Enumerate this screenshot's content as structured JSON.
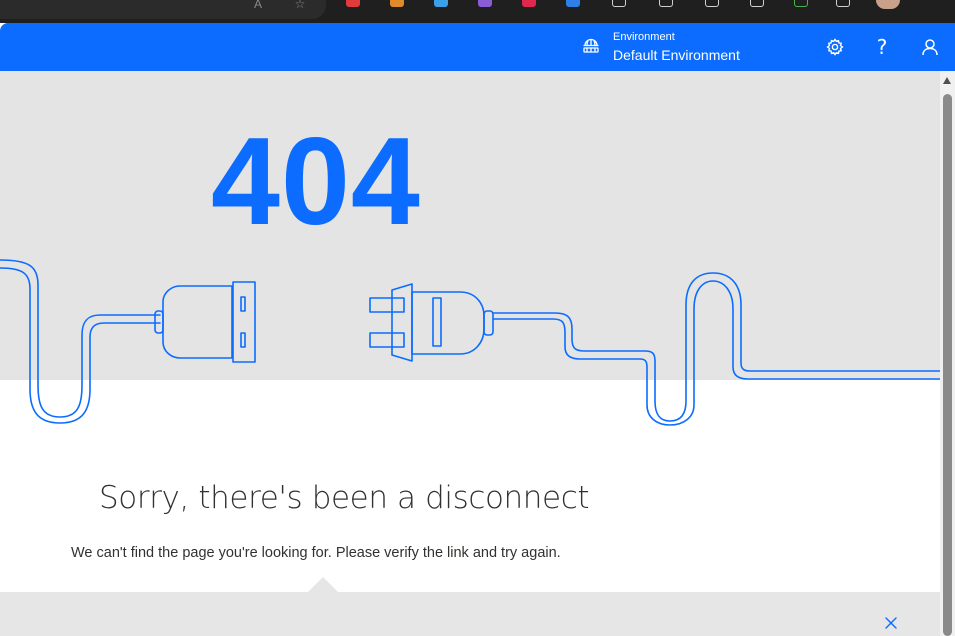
{
  "browser": {
    "address_bar_icons": [
      "read-aloud-icon",
      "favorite-star-icon"
    ],
    "extension_icons": [
      {
        "name": "red-extension-icon",
        "color": "#e23b3b"
      },
      {
        "name": "orange-extension-icon",
        "color": "#e08a2a"
      },
      {
        "name": "drive-extension-icon",
        "color": "#3aa0e8"
      },
      {
        "name": "purple-extension-icon",
        "color": "#8a5cd6"
      },
      {
        "name": "pinterest-extension-icon",
        "color": "#e0284c"
      },
      {
        "name": "blue-extension-icon",
        "color": "#2e7fe8"
      }
    ],
    "toolbar_icons": [
      "extensions-icon",
      "split-screen-icon",
      "favorites-icon",
      "collections-icon",
      "browser-essentials-icon",
      "copilot-icon",
      "profile-avatar"
    ]
  },
  "header": {
    "environment_label": "Environment",
    "environment_name": "Default Environment",
    "actions": [
      "settings-icon",
      "help-icon",
      "account-icon"
    ],
    "background_color": "#0b6cff"
  },
  "error": {
    "code": "404",
    "title": "Sorry, there's been a disconnect",
    "message": "We can't find the page you're looking for. Please verify the link and try again.",
    "accent_color": "#0b6cff"
  },
  "feedback": {
    "close_icon": "close-icon"
  }
}
